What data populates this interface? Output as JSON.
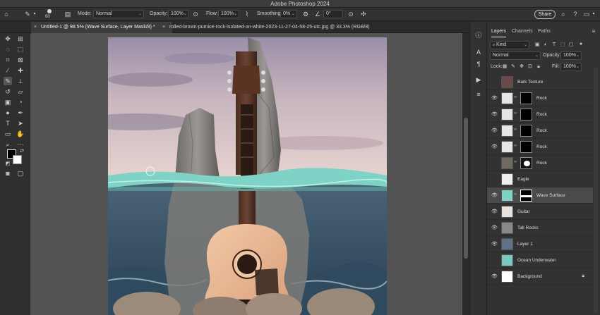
{
  "app": {
    "title": "Adobe Photoshop 2024"
  },
  "options_bar": {
    "brush_size": "60",
    "mode_label": "Mode:",
    "mode_value": "Normal",
    "opacity_label": "Opacity:",
    "opacity_value": "100%",
    "flow_label": "Flow:",
    "flow_value": "100%",
    "smoothing_label": "Smoothing:",
    "smoothing_value": "0%",
    "angle_value": "0°",
    "share_label": "Share"
  },
  "document_tabs": [
    {
      "label": "Untitled-1 @ 98.5% (Wave Surface, Layer Mask/8) *",
      "active": true
    },
    {
      "label": "rolled-brown-pumice-rock-isolated-on-white-2023-11-27-04-58-25-utc.jpg @ 33.3% (RGB/8)",
      "active": false
    }
  ],
  "layers_panel": {
    "tabs": [
      "Layers",
      "Channels",
      "Paths"
    ],
    "filter_label": "Kind",
    "blend_mode": "Normal",
    "opacity_label": "Opacity:",
    "opacity_value": "100%",
    "lock_label": "Lock:",
    "fill_label": "Fill:",
    "fill_value": "100%",
    "layers": [
      {
        "name": "Bark Texture",
        "visible": false,
        "has_mask": false,
        "thumb": "bark",
        "selected": false
      },
      {
        "name": "Rock",
        "visible": true,
        "has_mask": true,
        "thumb": "white",
        "mask": "dark",
        "selected": false
      },
      {
        "name": "Rock",
        "visible": true,
        "has_mask": true,
        "thumb": "white",
        "mask": "dark",
        "selected": false
      },
      {
        "name": "Rock",
        "visible": true,
        "has_mask": true,
        "thumb": "white",
        "mask": "dark",
        "selected": false
      },
      {
        "name": "Rock",
        "visible": true,
        "has_mask": true,
        "thumb": "white",
        "mask": "dark",
        "selected": false
      },
      {
        "name": "Rock",
        "visible": false,
        "has_mask": true,
        "thumb": "rock",
        "mask": "blob",
        "selected": false
      },
      {
        "name": "Eagle",
        "visible": false,
        "has_mask": false,
        "thumb": "white",
        "selected": false
      },
      {
        "name": "Wave Surface",
        "visible": true,
        "has_mask": true,
        "thumb": "teal",
        "mask": "wave",
        "selected": true
      },
      {
        "name": "Guitar",
        "visible": true,
        "has_mask": false,
        "thumb": "white",
        "selected": false
      },
      {
        "name": "Tall Rocks",
        "visible": true,
        "has_mask": false,
        "thumb": "rocks",
        "selected": false
      },
      {
        "name": "Layer 1",
        "visible": true,
        "has_mask": false,
        "thumb": "sea",
        "selected": false
      },
      {
        "name": "Ocean Underwater",
        "visible": false,
        "has_mask": false,
        "thumb": "teal",
        "selected": false
      },
      {
        "name": "Background",
        "visible": true,
        "has_mask": false,
        "thumb": "white",
        "locked": true,
        "selected": false
      }
    ]
  },
  "colors": {
    "accent": "#2f80ed",
    "water_teal": "#7fd3c6",
    "foreground": "#000000",
    "background": "#ffffff"
  }
}
